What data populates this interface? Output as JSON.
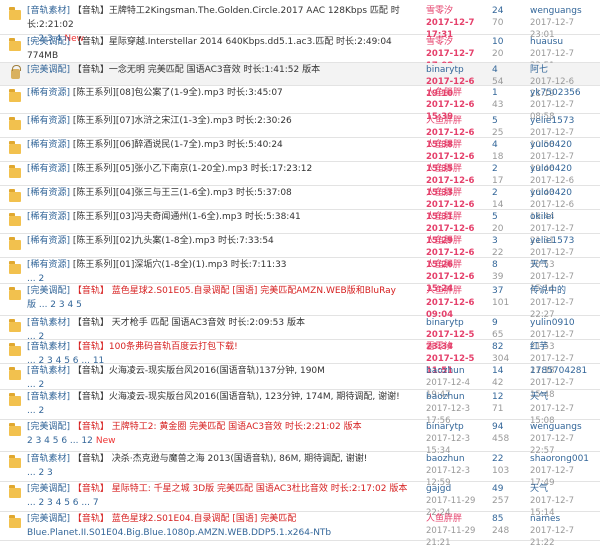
{
  "threads": [
    {
      "icon": "folder",
      "locked": false,
      "tag": "[音轨素材]",
      "line1": "【音轨】王牌特工2Kingsman.The.Golden.Circle.2017 AAC 128Kbps 匹配 时长:2:21:02",
      "line2": "... 2 3 4",
      "badge": "",
      "new_label": "New",
      "style": "normal",
      "author": "雪零汐",
      "author_style": "pink",
      "post_time": "2017-12-7 17:31",
      "post_time_hl": true,
      "replies": "24",
      "views": "70",
      "last_author": "wenguangs",
      "last_time": "2017-12-7 23:01"
    },
    {
      "icon": "folder",
      "locked": false,
      "tag": "[完美调配]",
      "line1": "【音轨】星际穿越.Interstellar 2014 640Kbps.dd5.1.ac3.匹配 时长:2:49:04 774MB",
      "line2": "... 2",
      "badge": "",
      "new_label": "",
      "style": "normal",
      "author": "雪零汐",
      "author_style": "pink",
      "post_time": "2017-12-7 17:08",
      "post_time_hl": true,
      "replies": "10",
      "views": "20",
      "last_author": "huausu",
      "last_time": "2017-12-7 22:51"
    },
    {
      "icon": "lock",
      "locked": true,
      "tag": "[完美调配]",
      "line1": "【音轨】一念无明 完美匹配 国语AC3音效 时长:1:41:52 版本",
      "line2": "",
      "badge": "",
      "new_label": "",
      "style": "normal",
      "author": "binarytp",
      "author_style": "blue",
      "post_time": "2017-12-6 19:10",
      "post_time_hl": true,
      "replies": "4",
      "views": "54",
      "last_author": "阿七",
      "last_time": "2017-12-6 21:19"
    },
    {
      "icon": "folder",
      "locked": false,
      "tag": "[稀有资源]",
      "line1": "[陈王系列][08]包公案了(1-9全).mp3 时长:3:45:07",
      "line2": "",
      "badge": "",
      "new_label": "",
      "style": "normal",
      "author": "人鱼胖胖",
      "author_style": "pink",
      "post_time": "2017-12-6 15:39",
      "post_time_hl": true,
      "replies": "1",
      "views": "43",
      "last_author": "yk7502356",
      "last_time": "2017-12-7 08:58"
    },
    {
      "icon": "folder",
      "locked": false,
      "tag": "[稀有资源]",
      "line1": "[陈王系列][07]水浒之宋江(1-3全).mp3 时长:2:30:26",
      "line2": "",
      "badge": "",
      "new_label": "",
      "style": "normal",
      "author": "人鱼胖胖",
      "author_style": "pink",
      "post_time": "2017-12-6 15:38",
      "post_time_hl": true,
      "replies": "5",
      "views": "25",
      "last_author": "yelie1573",
      "last_time": "2017-12-7 10:58"
    },
    {
      "icon": "folder",
      "locked": false,
      "tag": "[稀有资源]",
      "line1": "[陈王系列][06]醉酒说民(1-7全).mp3 时长:5:40:24",
      "line2": "",
      "badge": "",
      "new_label": "",
      "style": "normal",
      "author": "人鱼胖胖",
      "author_style": "pink",
      "post_time": "2017-12-6 15:35",
      "post_time_hl": true,
      "replies": "4",
      "views": "18",
      "last_author": "yulo0420",
      "last_time": "2017-12-7 19:46"
    },
    {
      "icon": "folder",
      "locked": false,
      "tag": "[稀有资源]",
      "line1": "[陈王系列][05]张小乙下南京(1-20全).mp3 时长:17:23:12",
      "line2": "",
      "badge": "",
      "new_label": "",
      "style": "normal",
      "author": "人鱼胖胖",
      "author_style": "pink",
      "post_time": "2017-12-6 15:33",
      "post_time_hl": true,
      "replies": "2",
      "views": "17",
      "last_author": "yulo0420",
      "last_time": "2017-12-6 16:43"
    },
    {
      "icon": "folder",
      "locked": false,
      "tag": "[稀有资源]",
      "line1": "[陈王系列][04]张三与王三(1-6全).mp3 时长:5:37:08",
      "line2": "",
      "badge": "",
      "new_label": "",
      "style": "normal",
      "author": "人鱼胖胖",
      "author_style": "pink",
      "post_time": "2017-12-6 15:31",
      "post_time_hl": true,
      "replies": "2",
      "views": "14",
      "last_author": "yulo0420",
      "last_time": "2017-12-6 16:44"
    },
    {
      "icon": "folder",
      "locked": false,
      "tag": "[稀有资源]",
      "line1": "[陈王系列][03]冯夫奇闻通州(1-6全).mp3 时长:5:38:41",
      "line2": "",
      "badge": "",
      "new_label": "",
      "style": "normal",
      "author": "人鱼胖胖",
      "author_style": "pink",
      "post_time": "2017-12-6 15:29",
      "post_time_hl": true,
      "replies": "5",
      "views": "20",
      "last_author": "okilei",
      "last_time": "2017-12-7 21:31"
    },
    {
      "icon": "folder",
      "locked": false,
      "tag": "[稀有资源]",
      "line1": "[陈王系列][02]九头案(1-8全).mp3 时长:7:33:54",
      "line2": "",
      "badge": "",
      "new_label": "",
      "style": "normal",
      "author": "人鱼胖胖",
      "author_style": "pink",
      "post_time": "2017-12-6 15:26",
      "post_time_hl": true,
      "replies": "3",
      "views": "22",
      "last_author": "yelie1573",
      "last_time": "2017-12-7 10:53"
    },
    {
      "icon": "folder",
      "locked": false,
      "tag": "[稀有资源]",
      "line1": "[陈王系列][01]深垢穴(1-8全)(1).mp3 时长:7:11:33",
      "line2": "... 2",
      "badge": "",
      "new_label": "",
      "style": "normal",
      "author": "人鱼胖胖",
      "author_style": "pink",
      "post_time": "2017-12-6 15:24",
      "post_time_hl": true,
      "replies": "8",
      "views": "39",
      "last_author": "天气",
      "last_time": "2017-12-7 15:14"
    },
    {
      "icon": "folder",
      "locked": false,
      "tag": "[完美调配]",
      "line1": "【音轨】 蓝色星球2.S01E05.自录调配 [国语] 完美匹配AMZN.WEB版和BluRay",
      "line2": "版  ... 2 3 4 5",
      "badge": "",
      "new_label": "",
      "style": "red",
      "author": "人鱼胖胖",
      "author_style": "pink",
      "post_time": "2017-12-6 09:04",
      "post_time_hl": true,
      "replies": "37",
      "views": "101",
      "last_author": "传说中的",
      "last_time": "2017-12-7 22:27"
    },
    {
      "icon": "folder",
      "locked": false,
      "tag": "[音轨素材]",
      "line1": "【音轨】 天才枪手 匹配 国语AC3音效 时长:2:09:53 版本",
      "line2": "... 2",
      "badge": "",
      "new_label": "",
      "style": "normal",
      "author": "binarytp",
      "author_style": "blue",
      "post_time": "2017-12-5 23:34",
      "post_time_hl": true,
      "replies": "9",
      "views": "65",
      "last_author": "yulin0910",
      "last_time": "2017-12-7 21:53"
    },
    {
      "icon": "folder",
      "locked": false,
      "tag": "[音轨素材]",
      "line1": "【音轨】100条弗码音轨百度云打包下载!",
      "line2": "... 2 3 4 5 6 ... 11",
      "badge": "",
      "new_label": "",
      "style": "red",
      "author": "雪零汐",
      "author_style": "pink",
      "post_time": "2017-12-5 11:51",
      "post_time_hl": true,
      "replies": "82",
      "views": "304",
      "last_author": "红芋",
      "last_time": "2017-12-7 21:38"
    },
    {
      "icon": "folder",
      "locked": false,
      "tag": "[音轨素材]",
      "line1": "【音轨】火海凌云-现实版台风2016(国语音轨)137分钟, 190M",
      "line2": "... 2",
      "badge": "",
      "new_label": "",
      "style": "normal",
      "author": "baozhun",
      "author_style": "blue",
      "post_time": "2017-12-4 19:47",
      "post_time_hl": false,
      "replies": "14",
      "views": "42",
      "last_author": "1785704281",
      "last_time": "2017-12-7 15:48"
    },
    {
      "icon": "folder",
      "locked": false,
      "tag": "[音轨素材]",
      "line1": "【音轨】火海凌云-现实版台风2016(国语音轨), 123分钟, 174M, 期待调配, 谢谢!",
      "line2": "... 2",
      "badge": "",
      "new_label": "",
      "style": "normal",
      "author": "baozhun",
      "author_style": "blue",
      "post_time": "2017-12-3 17:56",
      "post_time_hl": false,
      "replies": "12",
      "views": "71",
      "last_author": "天气",
      "last_time": "2017-12-7 15:08"
    },
    {
      "icon": "folder",
      "locked": false,
      "tag": "[完美调配]",
      "line1": "【音轨】 王牌特工2: 黄金圈 完美匹配 国语AC3音效 时长:2:21:02 版本",
      "line2": "2 3 4 5 6 ... 12",
      "badge": "",
      "new_label": "New",
      "style": "red",
      "author": "binarytp",
      "author_style": "blue",
      "post_time": "2017-12-3 15:34",
      "post_time_hl": false,
      "replies": "94",
      "views": "458",
      "last_author": "wenguangs",
      "last_time": "2017-12-7 22:57"
    },
    {
      "icon": "folder",
      "locked": false,
      "tag": "[音轨素材]",
      "line1": "【音轨】 决杀·杰克逊与魔兽之海 2013(国语音轨), 86M, 期待调配, 谢谢!",
      "line2": "... 2 3",
      "badge": "",
      "new_label": "",
      "style": "normal",
      "author": "baozhun",
      "author_style": "blue",
      "post_time": "2017-12-3 12:59",
      "post_time_hl": false,
      "replies": "22",
      "views": "103",
      "last_author": "shaorong001",
      "last_time": "2017-12-7 17:49"
    },
    {
      "icon": "folder",
      "locked": false,
      "tag": "[完美调配]",
      "line1": "【音轨】 星际特工: 千星之城 3D版 完美匹配 国语AC3杜比音效 时长:2:17:02 版本",
      "line2": "... 2 3 4 5 6 ... 7",
      "badge": "",
      "new_label": "",
      "style": "red",
      "author": "gajgd",
      "author_style": "blue",
      "post_time": "2017-11-29 22:24",
      "post_time_hl": false,
      "replies": "49",
      "views": "257",
      "last_author": "天气",
      "last_time": "2017-12-7 15:14"
    },
    {
      "icon": "folder",
      "locked": false,
      "tag": "[完美调配]",
      "line1": "【音轨】 蓝色星球2.S01E04.自录调配 [国语] 完美匹配",
      "line2": "Blue.Planet.II.S01E04.Big.Blue.1080p.AMZN.WEB.DDP5.1.x264-NTb",
      "badge": "",
      "new_label": "",
      "style": "red",
      "author": "人鱼胖胖",
      "author_style": "pink",
      "post_time": "2017-11-29 21:21",
      "post_time_hl": false,
      "replies": "85",
      "views": "248",
      "last_author": "names",
      "last_time": "2017-12-7 21:22"
    }
  ]
}
